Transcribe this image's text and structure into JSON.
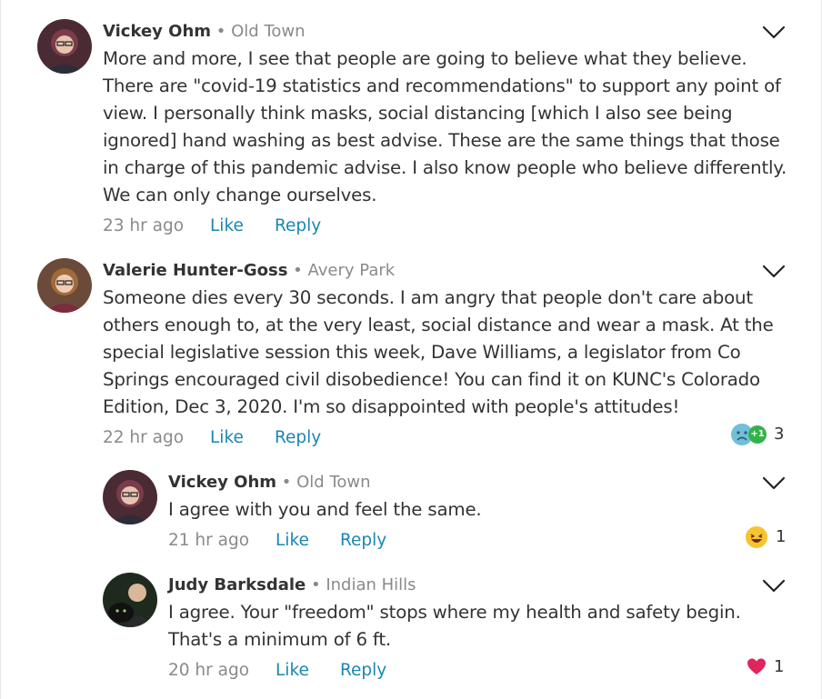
{
  "comments": [
    {
      "author": "Vickey Ohm",
      "separator": "•",
      "neighborhood": "Old Town",
      "text": "More and more, I see that people are going to believe what they believe. There are \"covid-19 statistics and recommendations\" to support any point of view. I personally think masks, social distancing [which I also see being ignored] hand washing as best advise. These are the same things that those in charge of this pandemic advise. I also know people who believe differently.  We can only change ourselves.",
      "time": "23 hr ago",
      "like_label": "Like",
      "reply_label": "Reply"
    },
    {
      "author": "Valerie Hunter-Goss",
      "separator": "•",
      "neighborhood": "Avery Park",
      "text": "Someone dies every 30 seconds. I am angry that people don't care about others enough to, at the very least, social distance and wear a mask. At the special legislative session this week, Dave Williams, a legislator from Co Springs encouraged civil disobedience! You can find it on KUNC's Colorado Edition, Dec 3, 2020. I'm so disappointed with people's attitudes!",
      "time": "22 hr ago",
      "like_label": "Like",
      "reply_label": "Reply",
      "reaction_icons": [
        "sad-face-icon",
        "plus-one-icon"
      ],
      "reaction_count": "3",
      "reaction_extra": "+1"
    },
    {
      "author": "Vickey Ohm",
      "separator": "•",
      "neighborhood": "Old Town",
      "text": "I agree with you and feel the same.",
      "time": "21 hr ago",
      "like_label": "Like",
      "reply_label": "Reply",
      "reaction_icons": [
        "laughing-face-icon"
      ],
      "reaction_count": "1"
    },
    {
      "author": "Judy Barksdale",
      "separator": "•",
      "neighborhood": "Indian Hills",
      "text": "I agree. Your \"freedom\" stops where my health and safety begin. That's a minimum of 6 ft.",
      "time": "20 hr ago",
      "like_label": "Like",
      "reply_label": "Reply",
      "reaction_icons": [
        "heart-icon"
      ],
      "reaction_count": "1"
    }
  ],
  "colors": {
    "link": "#1b86b3",
    "muted": "#8a8a8a",
    "text": "#333333",
    "heart": "#e0245e",
    "sad": "#6fc0d8",
    "plus_one": "#34b24a",
    "laugh": "#f7c32e"
  }
}
